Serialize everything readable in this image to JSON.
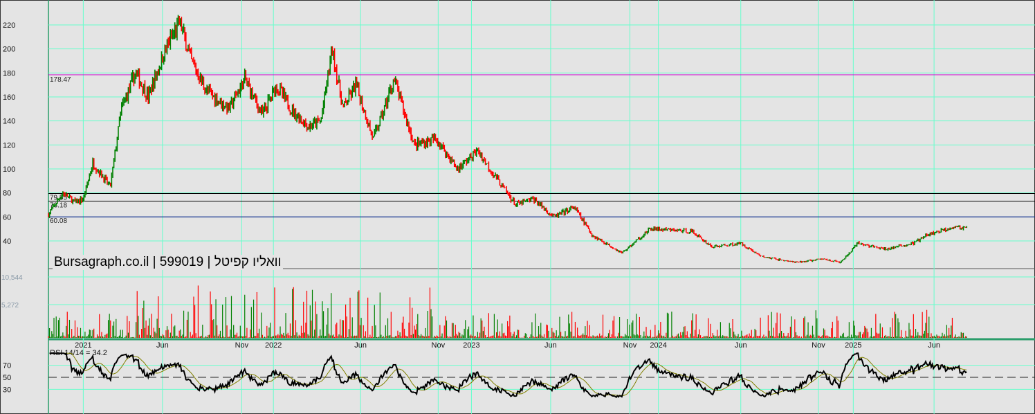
{
  "header": {
    "title": "Bursagraph.co.il | 599019 | וואליו קפיטל"
  },
  "chart_data": {
    "type": "candlestick",
    "title": "Bursagraph.co.il | 599019 | וואליו קפיטל",
    "x_unit": "months since Nov 2020",
    "x_ticks": [
      {
        "t": 2.2,
        "label": "2021"
      },
      {
        "t": 7.2,
        "label": "Jun"
      },
      {
        "t": 12.2,
        "label": "Nov"
      },
      {
        "t": 14.2,
        "label": "2022"
      },
      {
        "t": 19.7,
        "label": "Jun"
      },
      {
        "t": 24.6,
        "label": "Nov"
      },
      {
        "t": 26.7,
        "label": "2023"
      },
      {
        "t": 31.7,
        "label": "Jun"
      },
      {
        "t": 36.7,
        "label": "Nov"
      },
      {
        "t": 38.5,
        "label": "2024"
      },
      {
        "t": 43.7,
        "label": "Jun"
      },
      {
        "t": 48.6,
        "label": "Nov"
      },
      {
        "t": 50.8,
        "label": "2025"
      },
      {
        "t": 55.9,
        "label": "Jun"
      }
    ],
    "price_axis": {
      "ticks": [
        40,
        60,
        80,
        100,
        120,
        140,
        160,
        180,
        200,
        220
      ],
      "range": [
        20,
        232
      ]
    },
    "levels": [
      {
        "value": 178.47,
        "label": "178.47",
        "color": "#cc00cc"
      },
      {
        "value": 79.55,
        "label": "79.55",
        "color": "#000000"
      },
      {
        "value": 73.18,
        "label": "73.18",
        "color": "#000000"
      },
      {
        "value": 60.08,
        "label": "60.08",
        "color": "#000080"
      }
    ],
    "price_path": [
      [
        0,
        62
      ],
      [
        0.9,
        80
      ],
      [
        1.7,
        72
      ],
      [
        2.2,
        75
      ],
      [
        2.8,
        105
      ],
      [
        3.9,
        85
      ],
      [
        4.6,
        150
      ],
      [
        5.5,
        180
      ],
      [
        6.3,
        160
      ],
      [
        7.4,
        200
      ],
      [
        8.3,
        222
      ],
      [
        9.0,
        190
      ],
      [
        10.0,
        165
      ],
      [
        11.4,
        150
      ],
      [
        12.4,
        175
      ],
      [
        13.5,
        145
      ],
      [
        14.4,
        170
      ],
      [
        15.3,
        150
      ],
      [
        16.4,
        135
      ],
      [
        17.2,
        140
      ],
      [
        17.9,
        200
      ],
      [
        18.6,
        150
      ],
      [
        19.4,
        170
      ],
      [
        20.5,
        125
      ],
      [
        21.2,
        150
      ],
      [
        21.8,
        175
      ],
      [
        23.1,
        120
      ],
      [
        24.5,
        125
      ],
      [
        25.8,
        100
      ],
      [
        27.1,
        115
      ],
      [
        28.4,
        90
      ],
      [
        29.5,
        70
      ],
      [
        30.6,
        75
      ],
      [
        31.9,
        60
      ],
      [
        33.2,
        68
      ],
      [
        34.3,
        45
      ],
      [
        36.2,
        30
      ],
      [
        38.0,
        50
      ],
      [
        40.6,
        48
      ],
      [
        41.9,
        35
      ],
      [
        43.7,
        38
      ],
      [
        45.0,
        27
      ],
      [
        47.2,
        22
      ],
      [
        48.9,
        25
      ],
      [
        50.0,
        22
      ],
      [
        51.1,
        38
      ],
      [
        52.8,
        33
      ],
      [
        54.6,
        38
      ],
      [
        55.5,
        45
      ],
      [
        57.2,
        52
      ],
      [
        58.0,
        50
      ]
    ],
    "volume_axis": {
      "ticks": [
        "10,544",
        "5,272"
      ],
      "max": 12000
    },
    "rsi": {
      "label": "RSI 14/14 = 34.2",
      "period": 14,
      "value": 34.2,
      "ticks": [
        70,
        50,
        30
      ],
      "midline": 50
    },
    "colors": {
      "up": "#008000",
      "down": "#ff0000",
      "grid": "#66ffcc",
      "background": "#e4e4e4",
      "rsi": "#000000",
      "rsi_signal": "#808000"
    }
  }
}
